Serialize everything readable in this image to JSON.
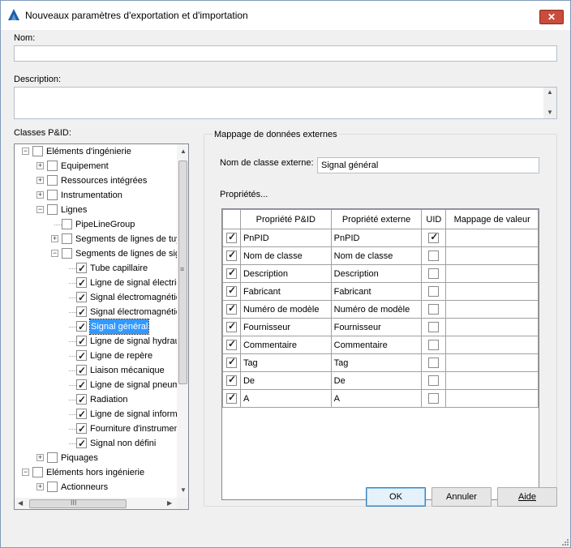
{
  "window": {
    "title": "Nouveaux paramètres d'exportation et d'importation",
    "close_label": "✕"
  },
  "form": {
    "name_label": "Nom:",
    "name_value": "",
    "description_label": "Description:",
    "description_value": "",
    "classes_label": "Classes P&ID:"
  },
  "tree": [
    {
      "label": "Eléments d'ingénierie",
      "level": 0,
      "expander": "minus",
      "checked": false
    },
    {
      "label": "Equipement",
      "level": 1,
      "expander": "plus",
      "checked": false
    },
    {
      "label": "Ressources intégrées",
      "level": 1,
      "expander": "plus",
      "checked": false
    },
    {
      "label": "Instrumentation",
      "level": 1,
      "expander": "plus",
      "checked": false
    },
    {
      "label": "Lignes",
      "level": 1,
      "expander": "minus",
      "checked": false
    },
    {
      "label": "PipeLineGroup",
      "level": 2,
      "expander": "none",
      "checked": false
    },
    {
      "label": "Segments de lignes de tuy",
      "level": 2,
      "expander": "plus",
      "checked": false
    },
    {
      "label": "Segments de lignes de sign",
      "level": 2,
      "expander": "minus",
      "checked": false
    },
    {
      "label": "Tube capillaire",
      "level": 3,
      "expander": "none",
      "checked": true
    },
    {
      "label": "Ligne de signal électric",
      "level": 3,
      "expander": "none",
      "checked": true
    },
    {
      "label": "Signal électromagnétic",
      "level": 3,
      "expander": "none",
      "checked": true
    },
    {
      "label": "Signal électromagnétic",
      "level": 3,
      "expander": "none",
      "checked": true
    },
    {
      "label": "Signal général",
      "level": 3,
      "expander": "none",
      "checked": true,
      "selected": true
    },
    {
      "label": "Ligne de signal hydrau",
      "level": 3,
      "expander": "none",
      "checked": true
    },
    {
      "label": "Ligne de repère",
      "level": 3,
      "expander": "none",
      "checked": true
    },
    {
      "label": "Liaison mécanique",
      "level": 3,
      "expander": "none",
      "checked": true
    },
    {
      "label": "Ligne de signal pneum",
      "level": 3,
      "expander": "none",
      "checked": true
    },
    {
      "label": "Radiation",
      "level": 3,
      "expander": "none",
      "checked": true
    },
    {
      "label": "Ligne de signal informa",
      "level": 3,
      "expander": "none",
      "checked": true
    },
    {
      "label": "Fourniture d'instrument",
      "level": 3,
      "expander": "none",
      "checked": true
    },
    {
      "label": "Signal non défini",
      "level": 3,
      "expander": "none",
      "checked": true
    },
    {
      "label": "Piquages",
      "level": 1,
      "expander": "plus",
      "checked": false
    },
    {
      "label": "Eléments hors ingénierie",
      "level": 0,
      "expander": "minus",
      "checked": false
    },
    {
      "label": "Actionneurs",
      "level": 1,
      "expander": "plus",
      "checked": false
    }
  ],
  "tree_scroll": {
    "hscroll_grip": "III",
    "vscroll_grip": "≡"
  },
  "mapping": {
    "group_title": "Mappage de données externes",
    "external_class_label": "Nom de classe externe:",
    "external_class_value": "Signal général",
    "properties_label": "Propriétés...",
    "columns": [
      "Propriété P&ID",
      "Propriété externe",
      "UID",
      "Mappage de valeur"
    ],
    "rows": [
      {
        "checked": true,
        "pid": "PnPID",
        "ext": "PnPID",
        "uid": true,
        "map": ""
      },
      {
        "checked": true,
        "pid": "Nom de classe",
        "ext": "Nom de classe",
        "uid": false,
        "map": ""
      },
      {
        "checked": true,
        "pid": "Description",
        "ext": "Description",
        "uid": false,
        "map": ""
      },
      {
        "checked": true,
        "pid": "Fabricant",
        "ext": "Fabricant",
        "uid": false,
        "map": ""
      },
      {
        "checked": true,
        "pid": "Numéro de modèle",
        "ext": "Numéro de modèle",
        "uid": false,
        "map": ""
      },
      {
        "checked": true,
        "pid": "Fournisseur",
        "ext": "Fournisseur",
        "uid": false,
        "map": ""
      },
      {
        "checked": true,
        "pid": "Commentaire",
        "ext": "Commentaire",
        "uid": false,
        "map": ""
      },
      {
        "checked": true,
        "pid": "Tag",
        "ext": "Tag",
        "uid": false,
        "map": ""
      },
      {
        "checked": true,
        "pid": "De",
        "ext": "De",
        "uid": false,
        "map": ""
      },
      {
        "checked": true,
        "pid": "A",
        "ext": "A",
        "uid": false,
        "map": ""
      }
    ]
  },
  "buttons": {
    "ok": "OK",
    "cancel": "Annuler",
    "help": "Aide"
  },
  "colors": {
    "selection": "#3399ff",
    "close": "#c94c3c",
    "default_button_border": "#3c7fb1"
  }
}
